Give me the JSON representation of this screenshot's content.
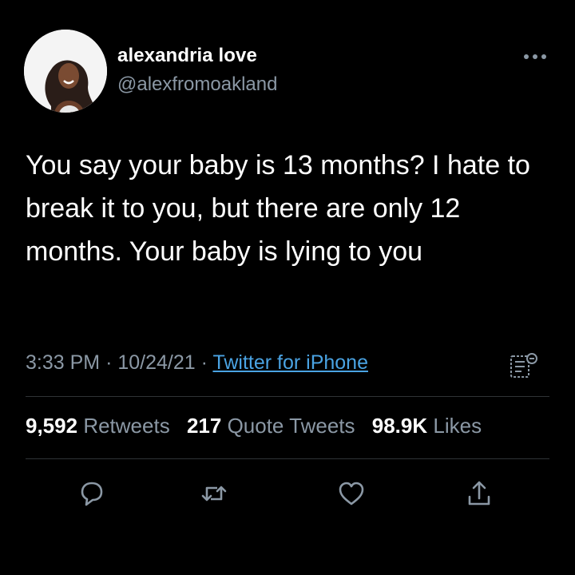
{
  "author": {
    "display_name": "alexandria love",
    "handle": "@alexfromoakland",
    "avatar_icon": "profile-photo"
  },
  "tweet": {
    "text": "You say your baby is 13 months? I hate to break it to you, but there are only 12 months. Your baby is lying to you",
    "time": "3:33 PM",
    "separator": "·",
    "date": "10/24/21",
    "source": "Twitter for iPhone"
  },
  "stats": {
    "retweets_count": "9,592",
    "retweets_label": "Retweets",
    "quotes_count": "217",
    "quotes_label": "Quote Tweets",
    "likes_count": "98.9K",
    "likes_label": "Likes"
  },
  "icons": {
    "more": "more-dots-icon",
    "translate": "translate-doc-icon",
    "reply": "reply-icon",
    "retweet": "retweet-icon",
    "like": "heart-icon",
    "share": "share-icon"
  },
  "colors": {
    "background": "#000000",
    "text_primary": "#ffffff",
    "text_secondary": "#8b98a5",
    "link": "#4aa3e3",
    "divider": "#2f3336"
  }
}
